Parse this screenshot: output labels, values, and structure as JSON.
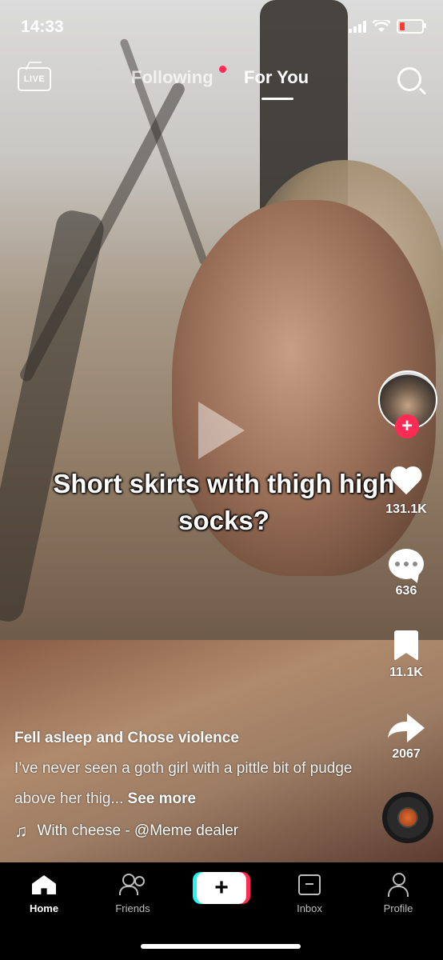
{
  "status_bar": {
    "time": "14:33"
  },
  "top_nav": {
    "live_label": "LIVE",
    "tabs": [
      {
        "label": "Following",
        "active": false,
        "has_notification_dot": true
      },
      {
        "label": "For You",
        "active": true
      }
    ]
  },
  "video": {
    "overlay_caption": "Short skirts with thigh high socks?"
  },
  "actions": {
    "likes": "131.1K",
    "comments": "636",
    "saves": "11.1K",
    "shares": "2067"
  },
  "post": {
    "author": "Fell asleep and Chose violence",
    "description": "I’ve never seen a goth girl with a pittle bit of pudge above her thig...",
    "see_more": "See more",
    "sound": "With cheese - @Meme dealer"
  },
  "bottom_nav": {
    "items": [
      {
        "label": "Home",
        "active": true
      },
      {
        "label": "Friends",
        "active": false
      },
      {
        "label": "Inbox",
        "active": false
      },
      {
        "label": "Profile",
        "active": false
      }
    ],
    "create_label": "+"
  },
  "colors": {
    "accent": "#fe2c55",
    "cyan": "#25f4ee",
    "background": "#000000"
  }
}
